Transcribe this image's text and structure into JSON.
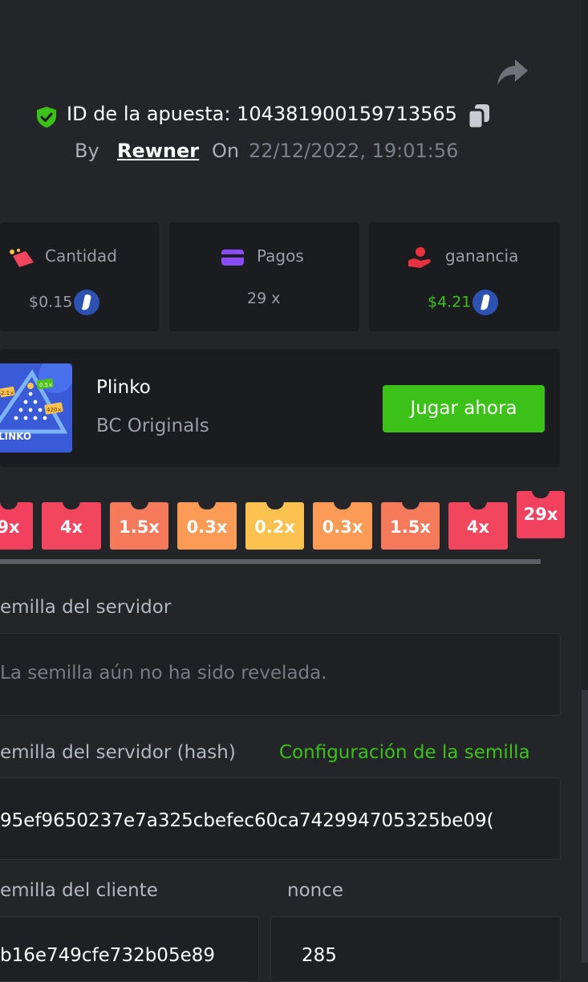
{
  "header": {
    "bet_id_label": "ID de la apuesta: 104381900159713565",
    "by_label": "By",
    "username": "Rewner",
    "on_label": "On",
    "datetime": "22/12/2022, 19:01:56"
  },
  "stats": [
    {
      "label": "Cantidad",
      "value": "$0.15",
      "icon": "money-icon",
      "color": "#9a9ea7"
    },
    {
      "label": "Pagos",
      "value": "29 x",
      "icon": "card-icon",
      "color": "#9a9ea7"
    },
    {
      "label": "ganancia",
      "value": "$4.21",
      "icon": "profit-hand-icon",
      "color": "#3bc117"
    }
  ],
  "game": {
    "name": "Plinko",
    "provider": "BC Originals",
    "play_label": "Jugar ahora",
    "thumb": {
      "brand": "LINKO",
      "tag1": "0.5×",
      "tag2": "2.1×",
      "tag3": "420×"
    }
  },
  "buckets": [
    {
      "label": "9x",
      "color": "#f2415e"
    },
    {
      "label": "4x",
      "color": "#f2465f"
    },
    {
      "label": "1.5x",
      "color": "#f57a5c"
    },
    {
      "label": "0.3x",
      "color": "#fb9b55"
    },
    {
      "label": "0.2x",
      "color": "#fbc24f"
    },
    {
      "label": "0.3x",
      "color": "#fb9b55"
    },
    {
      "label": "1.5x",
      "color": "#f57a5c"
    },
    {
      "label": "4x",
      "color": "#f2465f"
    },
    {
      "label": "29x",
      "color": "#f2415e",
      "hit": true
    }
  ],
  "seeds": {
    "server_seed_label": "emilla del servidor",
    "server_seed_value": "La semilla aún no ha sido revelada.",
    "server_hash_label": "emilla del servidor (hash)",
    "seed_settings_link": "Configuración de la semilla",
    "server_hash_value": "95ef9650237e7a325cbefec60ca742994705325be09(",
    "client_seed_label": "emilla del cliente",
    "nonce_label": "nonce",
    "client_seed_value": "b16e749cfe732b05e89",
    "nonce_value": "285"
  },
  "colors": {
    "accent": "#3bc117",
    "background": "#232529",
    "card": "#1b1c1f"
  }
}
